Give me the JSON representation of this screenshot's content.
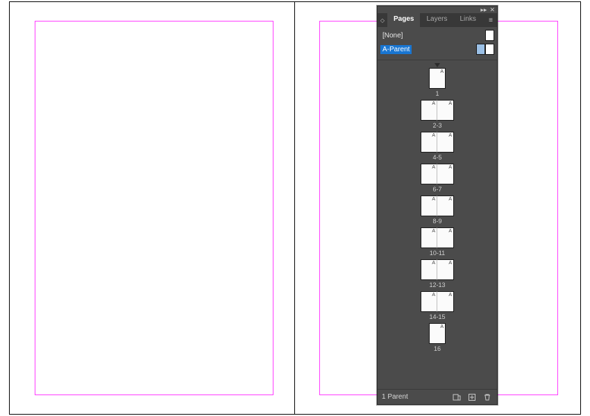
{
  "canvas": {
    "spread_pages": 2
  },
  "panel": {
    "tabs": {
      "pages": "Pages",
      "layers": "Layers",
      "links": "Links",
      "active": "pages"
    },
    "parents": {
      "none_label": "[None]",
      "a_parent_label": "A-Parent"
    },
    "spreads": [
      {
        "label": "1",
        "pages": [
          "A"
        ]
      },
      {
        "label": "2-3",
        "pages": [
          "A",
          "A"
        ]
      },
      {
        "label": "4-5",
        "pages": [
          "A",
          "A"
        ]
      },
      {
        "label": "6-7",
        "pages": [
          "A",
          "A"
        ]
      },
      {
        "label": "8-9",
        "pages": [
          "A",
          "A"
        ]
      },
      {
        "label": "10-11",
        "pages": [
          "A",
          "A"
        ]
      },
      {
        "label": "12-13",
        "pages": [
          "A",
          "A"
        ]
      },
      {
        "label": "14-15",
        "pages": [
          "A",
          "A"
        ]
      },
      {
        "label": "16",
        "pages": [
          "A"
        ]
      }
    ],
    "footer": {
      "status": "1 Parent"
    }
  }
}
